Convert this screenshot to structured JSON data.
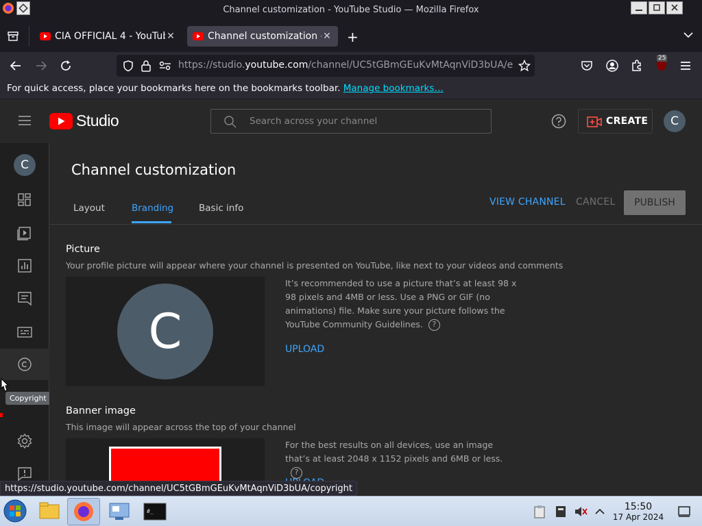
{
  "window": {
    "title": "Channel customization - YouTube Studio — Mozilla Firefox"
  },
  "browser": {
    "tabs": [
      {
        "label": "CIA OFFICIAL 4 - YouTube",
        "active": false
      },
      {
        "label": "Channel customization - ",
        "active": true
      }
    ],
    "url_prefix": "https://studio.",
    "url_domain": "youtube.com",
    "url_path": "/channel/UC5tGBmGEuKvMtAqnViD3bUA/e",
    "extension_badge": "25",
    "bookmarks_message": "For quick access, place your bookmarks here on the bookmarks toolbar.",
    "bookmarks_link": "Manage bookmarks…",
    "status_url": "https://studio.youtube.com/channel/UC5tGBmGEuKvMtAqnViD3bUA/copyright"
  },
  "studio": {
    "logo_text": "Studio",
    "search_placeholder": "Search across your channel",
    "create_label": "CREATE",
    "avatar_letter": "C",
    "sidebar_tooltip": "Copyright"
  },
  "page": {
    "title": "Channel customization",
    "tabs": [
      {
        "label": "Layout"
      },
      {
        "label": "Branding"
      },
      {
        "label": "Basic info"
      }
    ],
    "view_channel": "VIEW CHANNEL",
    "cancel": "CANCEL",
    "publish": "PUBLISH",
    "picture": {
      "title": "Picture",
      "description": "Your profile picture will appear where your channel is presented on YouTube, like next to your videos and comments",
      "recommendation": "It’s recommended to use a picture that’s at least 98 x 98 pixels and 4MB or less. Use a PNG or GIF (no animations) file. Make sure your picture follows the YouTube Community Guidelines.",
      "upload": "UPLOAD",
      "avatar_letter": "C"
    },
    "banner": {
      "title": "Banner image",
      "description": "This image will appear across the top of your channel",
      "recommendation": "For the best results on all devices, use an image that’s at least 2048 x 1152 pixels and 6MB or less.",
      "upload": "UPLOAD"
    }
  },
  "taskbar": {
    "time": "15:50",
    "date": "17 Apr 2024"
  },
  "colors": {
    "accent_blue": "#3ea6ff",
    "youtube_red": "#ff0000",
    "avatar_bg": "#4d5c69"
  }
}
